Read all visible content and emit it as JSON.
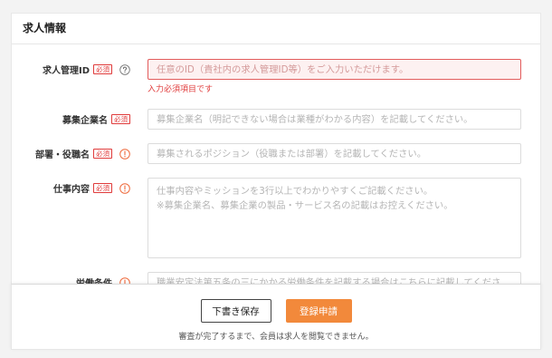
{
  "section": {
    "title": "求人情報"
  },
  "fields": [
    {
      "label": "求人管理ID",
      "required_badge": "必須",
      "help_icon": "question-circle-icon",
      "placeholder": "任意のID（貴社内の求人管理ID等）をご入力いただけます。",
      "value": "",
      "error": "入力必須項目です"
    },
    {
      "label": "募集企業名",
      "required_badge": "必須",
      "placeholder": "募集企業名（明記できない場合は業種がわかる内容）を記載してください。",
      "value": ""
    },
    {
      "label": "部署・役職名",
      "required_badge": "必須",
      "help_icon": "alert-circle-icon",
      "placeholder": "募集されるポジション（役職または部署）を記載してください。",
      "value": ""
    },
    {
      "label": "仕事内容",
      "required_badge": "必須",
      "help_icon": "alert-circle-icon",
      "placeholder": "仕事内容やミッションを3行以上でわかりやすくご記載ください。\n※募集企業名、募集企業の製品・サービス名の記載はお控えください。",
      "value": ""
    },
    {
      "label": "労働条件",
      "help_icon": "alert-circle-icon",
      "placeholder": "職業安定法第五条の三にかかる労働条件を記載する場合はこちらに記載してくださ",
      "value": ""
    }
  ],
  "footer": {
    "draft_button": "下書き保存",
    "submit_button": "登録申請",
    "note": "審査が完了するまで、会員は求人を閲覧できません。"
  },
  "colors": {
    "accent": "#f2893b",
    "required": "#e03b3b",
    "error_border": "#e35d5d",
    "error_background": "#fdf1f1",
    "info_icon": "#ee6a3c",
    "page_background": "#f3f3f3"
  }
}
